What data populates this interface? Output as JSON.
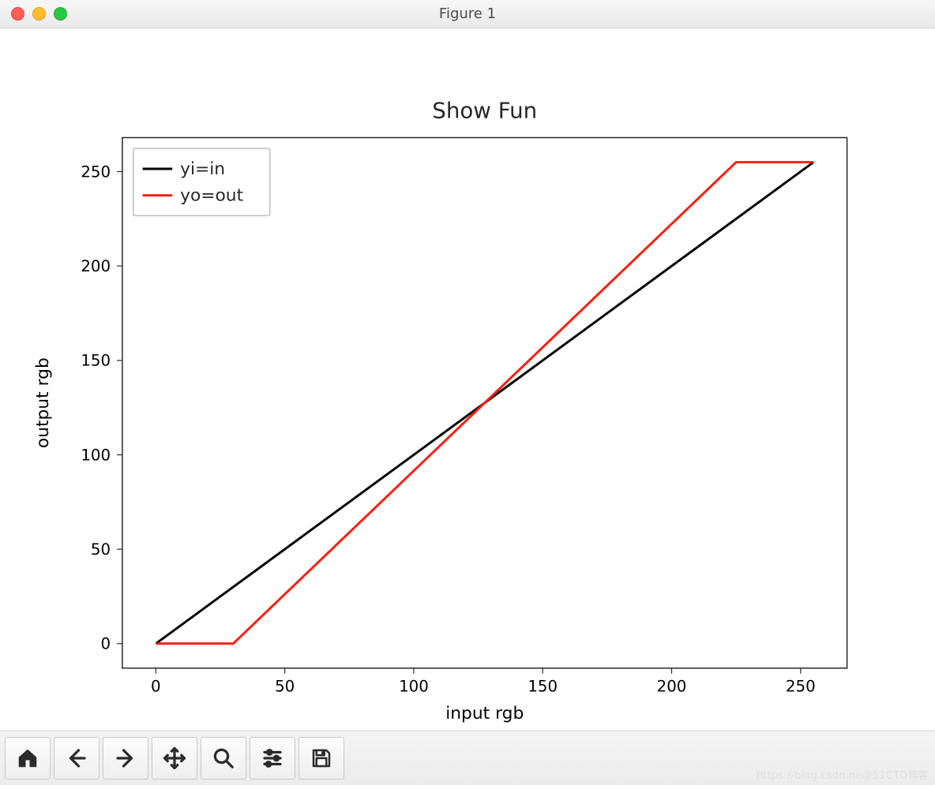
{
  "window": {
    "title": "Figure 1"
  },
  "toolbar": {
    "home": "Home",
    "back": "Back",
    "forward": "Forward",
    "pan": "Pan",
    "zoom": "Zoom",
    "config": "Configure subplots",
    "save": "Save"
  },
  "watermark": "https://blog.csdn.ne@51CTO博客",
  "chart_data": {
    "type": "line",
    "title": "Show Fun",
    "xlabel": "input rgb",
    "ylabel": "output rgb",
    "xlim": [
      -13,
      268
    ],
    "ylim": [
      -13,
      268
    ],
    "xticks": [
      0,
      50,
      100,
      150,
      200,
      250
    ],
    "yticks": [
      0,
      50,
      100,
      150,
      200,
      250
    ],
    "legend": {
      "location": "upper left",
      "entries": [
        "yi=in",
        "yo=out"
      ]
    },
    "series": [
      {
        "name": "yi=in",
        "color": "#000000",
        "x": [
          0,
          255
        ],
        "y": [
          0,
          255
        ]
      },
      {
        "name": "yo=out",
        "color": "#fb1e10",
        "x": [
          0,
          30,
          225,
          255
        ],
        "y": [
          0,
          0,
          255,
          255
        ]
      }
    ]
  }
}
